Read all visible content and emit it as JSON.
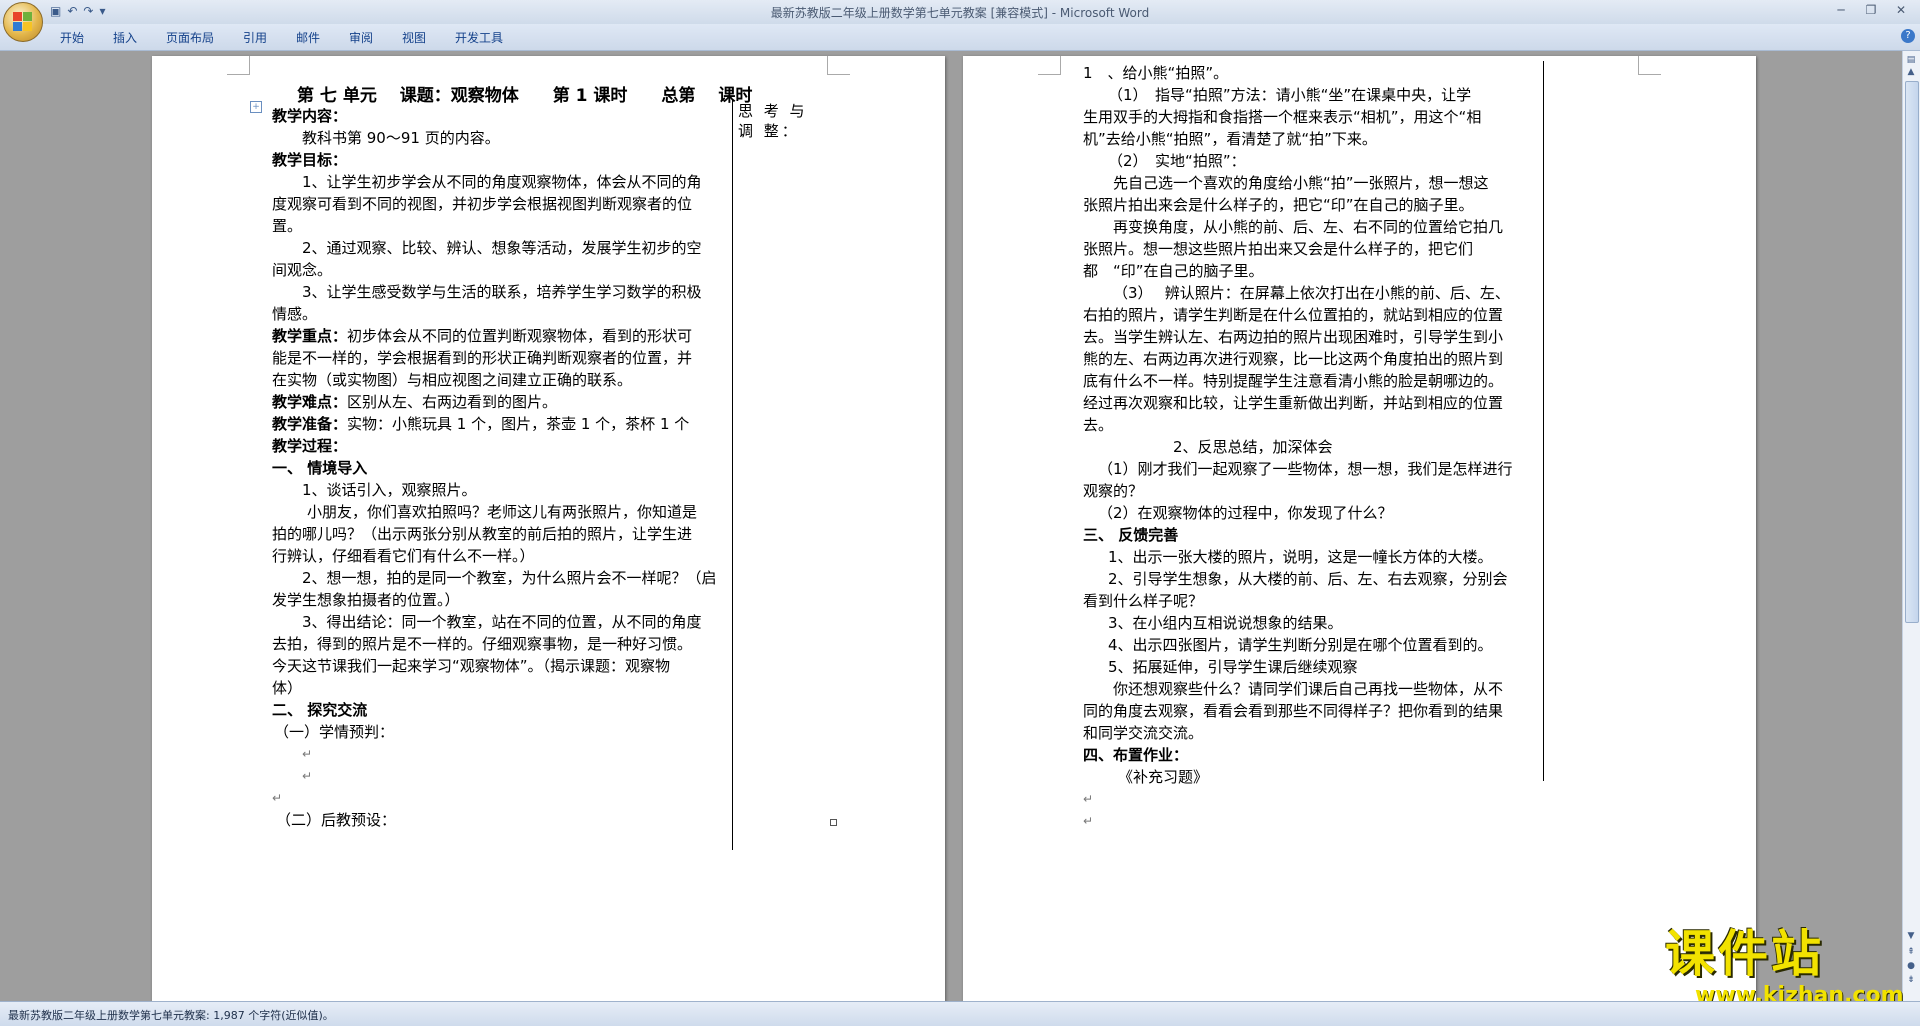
{
  "window": {
    "title": "最新苏教版二年级上册数学第七单元教案 [兼容模式] - Microsoft Word",
    "qat_icons": [
      "save-icon",
      "undo-icon",
      "redo-icon",
      "customize-icon"
    ],
    "controls": [
      "minimize-icon",
      "restore-icon",
      "close-icon"
    ]
  },
  "ribbon": {
    "tabs": [
      "开始",
      "插入",
      "页面布局",
      "引用",
      "邮件",
      "审阅",
      "视图",
      "开发工具"
    ]
  },
  "left_page": {
    "title": "第 七 单元　 课题：观察物体　　第 1 课时　　总第　 课时",
    "side_label": "思 考 与 调 整：",
    "sections": {
      "content_label": "教学内容：",
      "content_text": "教科书第 90～91 页的内容。",
      "goals_label": "教学目标：",
      "goal1_a": "1、让学生初步学会从不同的角度观察物体，体会从不同的角",
      "goal1_b": "度观察可看到不同的视图，并初步学会根据视图判断观察者的位",
      "goal1_c": "置。",
      "goal2_a": "2、通过观察、比较、辨认、想象等活动，发展学生初步的空",
      "goal2_b": "间观念。",
      "goal3_a": "3、让学生感受数学与生活的联系，培养学生学习数学的积极",
      "goal3_b": "情感。",
      "key_label": "教学重点：",
      "key_a": "初步体会从不同的位置判断观察物体，看到的形状可",
      "key_b": "能是不一样的，学会根据看到的形状正确判断观察者的位置，并",
      "key_c": "在实物（或实物图）与相应视图之间建立正确的联系。",
      "diff_label": "教学难点：",
      "diff_text": "区别从左、右两边看到的图片。",
      "prep_label": "教学准备：",
      "prep_text": "实物：小熊玩具 1 个，图片，茶壶 1 个，茶杯 1 个",
      "process_label": "教学过程：",
      "s1_title": "一、 情境导入",
      "s1_1": "1、谈话引入，观察照片。",
      "s1_p_a": "小朋友，你们喜欢拍照吗？老师这儿有两张照片，你知道是",
      "s1_p_b": "拍的哪儿吗？（出示两张分别从教室的前后拍的照片，让学生进",
      "s1_p_c": "行辨认，仔细看看它们有什么不一样。）",
      "s1_2_a": "2、想一想，拍的是同一个教室，为什么照片会不一样呢？（启",
      "s1_2_b": "发学生想象拍摄者的位置。）",
      "s1_3_a": "3、得出结论：同一个教室，站在不同的位置，从不同的角度",
      "s1_3_b": "去拍，得到的照片是不一样的。仔细观察事物，是一种好习惯。",
      "s1_3_c": "今天这节课我们一起来学习“观察物体”。（揭示课题：观察物",
      "s1_3_d": "体）",
      "s2_title": "二、 探究交流",
      "s2_1": "（一）学情预判：",
      "s2_2": "（二）后教预设："
    }
  },
  "right_page": {
    "lines": {
      "r1": "1　、给小熊“拍照”。",
      "r2": "（1）　指导“拍照”方法：请小熊“坐”在课桌中央，让学",
      "r3": "生用双手的大拇指和食指搭一个框来表示“相机”，用这个“相",
      "r4": "机”去给小熊“拍照”，看清楚了就“拍”下来。",
      "r5": "（2）　实地“拍照”：",
      "r6": "先自己选一个喜欢的角度给小熊“拍”一张照片，想一想这",
      "r7": "张照片拍出来会是什么样子的，把它“印”在自己的脑子里。",
      "r8": "再变换角度，从小熊的前、后、左、右不同的位置给它拍几",
      "r9": "张照片。想一想这些照片拍出来又会是什么样子的，把它们",
      "r10": "都　“印”在自己的脑子里。",
      "r11": "（3）　 辨认照片：在屏幕上依次打出在小熊的前、后、左、",
      "r12": "右拍的照片，请学生判断是在什么位置拍的，就站到相应的位置",
      "r13": "去。当学生辨认左、右两边拍的照片出现困难时，引导学生到小",
      "r14": "熊的左、右两边再次进行观察，比一比这两个角度拍出的照片到",
      "r15": "底有什么不一样。特别提醒学生注意看清小熊的脸是朝哪边的。",
      "r16": "经过再次观察和比较，让学生重新做出判断，并站到相应的位置",
      "r17": "去。",
      "r18": "2、反思总结，加深体会",
      "r19": "（1）刚才我们一起观察了一些物体，想一想，我们是怎样进行",
      "r20": "观察的？",
      "r21": "（2）在观察物体的过程中，你发现了什么？",
      "r22": "三、 反馈完善",
      "r23": "1、出示一张大楼的照片，说明，这是一幢长方体的大楼。",
      "r24": "2、引导学生想象，从大楼的前、后、左、右去观察，分别会",
      "r25": "看到什么样子呢？",
      "r26": "3、在小组内互相说说想象的结果。",
      "r27": "4、出示四张图片，请学生判断分别是在哪个位置看到的。",
      "r28": "5、拓展延伸，引导学生课后继续观察",
      "r29": "你还想观察些什么？请同学们课后自己再找一些物体，从不",
      "r30": "同的角度去观察，看看会看到那些不同得样子？把你看到的结果",
      "r31": "和同学交流交流。",
      "r32": "四、布置作业：",
      "r33": "《补充习题》"
    }
  },
  "status": {
    "text": "最新苏教版二年级上册数学第七单元教案: 1,987 个字符(近似值)。"
  },
  "watermark": {
    "text": "课件站",
    "url": "www.kjzhan.com"
  }
}
